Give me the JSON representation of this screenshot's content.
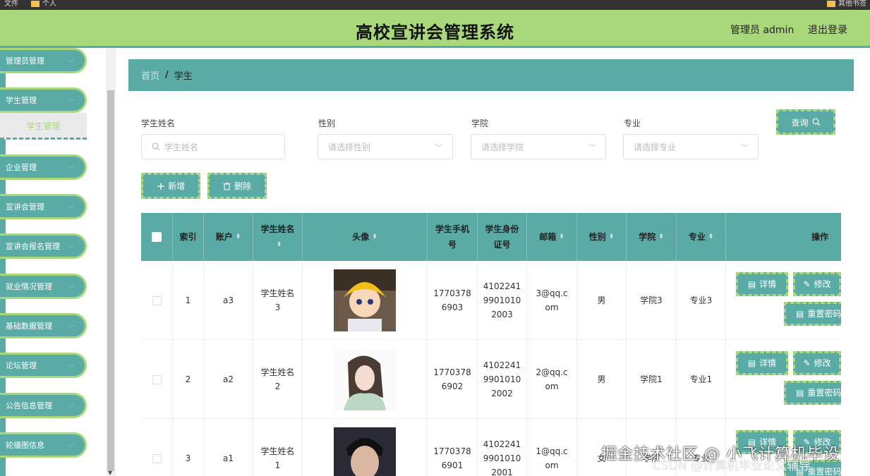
{
  "topbar": {
    "left_text": "文件",
    "left_folder": "个人",
    "right_folder": "其他书签"
  },
  "header": {
    "title": "高校宣讲会管理系统",
    "admin": "管理员 admin",
    "logout": "退出登录"
  },
  "sidebar": {
    "items": [
      {
        "label": "管理员管理"
      },
      {
        "label": "学生管理"
      },
      {
        "label": "企业管理"
      },
      {
        "label": "宣讲会管理"
      },
      {
        "label": "宣讲会报名管理"
      },
      {
        "label": "就业情况管理"
      },
      {
        "label": "基础数据管理"
      },
      {
        "label": "论坛管理"
      },
      {
        "label": "公告信息管理"
      },
      {
        "label": "轮播图信息"
      }
    ],
    "submenu": "学生管理"
  },
  "breadcrumb": {
    "home": "首页",
    "sep": "/",
    "current": "学生"
  },
  "filters": {
    "name_label": "学生姓名",
    "name_placeholder": "学生姓名",
    "gender_label": "性别",
    "gender_placeholder": "请选择性别",
    "college_label": "学院",
    "college_placeholder": "请选择学院",
    "major_label": "专业",
    "major_placeholder": "请选择专业",
    "query_button": "查询"
  },
  "actions": {
    "add": "新增",
    "delete": "删除"
  },
  "table": {
    "headers": {
      "index": "索引",
      "account": "账户",
      "name": "学生姓名",
      "avatar": "头像",
      "phone": "学生手机号",
      "idcard": "学生身份证号",
      "email": "邮箱",
      "gender": "性别",
      "college": "学院",
      "major": "专业",
      "ops": "操作"
    },
    "rows": [
      {
        "index": "1",
        "account": "a3",
        "name": "学生姓名3",
        "phone": "17703786903",
        "idcard": "410224199010102003",
        "email": "3@qq.com",
        "gender": "男",
        "college": "学院3",
        "major": "专业3"
      },
      {
        "index": "2",
        "account": "a2",
        "name": "学生姓名2",
        "phone": "17703786902",
        "idcard": "410224199010102002",
        "email": "2@qq.com",
        "gender": "男",
        "college": "学院1",
        "major": "专业1"
      },
      {
        "index": "3",
        "account": "a1",
        "name": "学生姓名1",
        "phone": "17703786901",
        "idcard": "410224199010102001",
        "email": "1@qq.com",
        "gender": "女",
        "college": "学院",
        "major": "专业"
      }
    ],
    "op_detail": "详情",
    "op_edit": "修改",
    "op_reset": "重置密码"
  },
  "watermark": {
    "line1": "掘金技术社区 @ 小飞计算机毕设",
    "line2": "CSDN @计算机毕业论文辅导"
  }
}
